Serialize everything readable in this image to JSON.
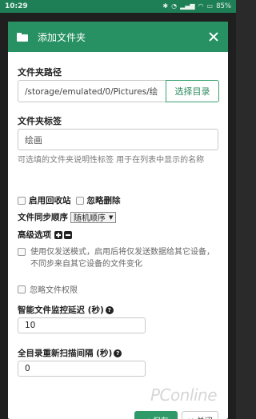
{
  "status_bar": {
    "time": "10:29",
    "battery": "85%"
  },
  "dialog": {
    "title": "添加文件夹",
    "folder_path": {
      "label": "文件夹路径",
      "value": "/storage/emulated/0/Pictures/绘",
      "browse_button": "选择目录"
    },
    "folder_label": {
      "label": "文件夹标签",
      "value": "绘画",
      "help": "可选填的文件夹说明性标签 用于在列表中显示的名称"
    },
    "options": {
      "enable_trash": "启用回收站",
      "ignore_delete": "忽略删除"
    },
    "pull_order": {
      "label": "文件同步顺序",
      "selected": "随机顺序"
    },
    "advanced": {
      "label": "高级选项",
      "send_only": "使用仅发送模式，启用后将仅发送数据给其它设备，不同步来自其它设备的文件变化",
      "ignore_permissions": "忽略文件权限",
      "fs_watcher_delay": {
        "label": "智能文件监控延迟 (秒)",
        "value": "10"
      },
      "rescan_interval": {
        "label": "全目录重新扫描间隔 (秒)",
        "value": "0"
      }
    },
    "footer": {
      "save": "✔ 保存",
      "cancel": "✕ 关闭"
    }
  },
  "watermark": "PConline",
  "colors": {
    "header": "#279163",
    "status_bar": "#1e7f56",
    "accent": "#2f9a68"
  }
}
